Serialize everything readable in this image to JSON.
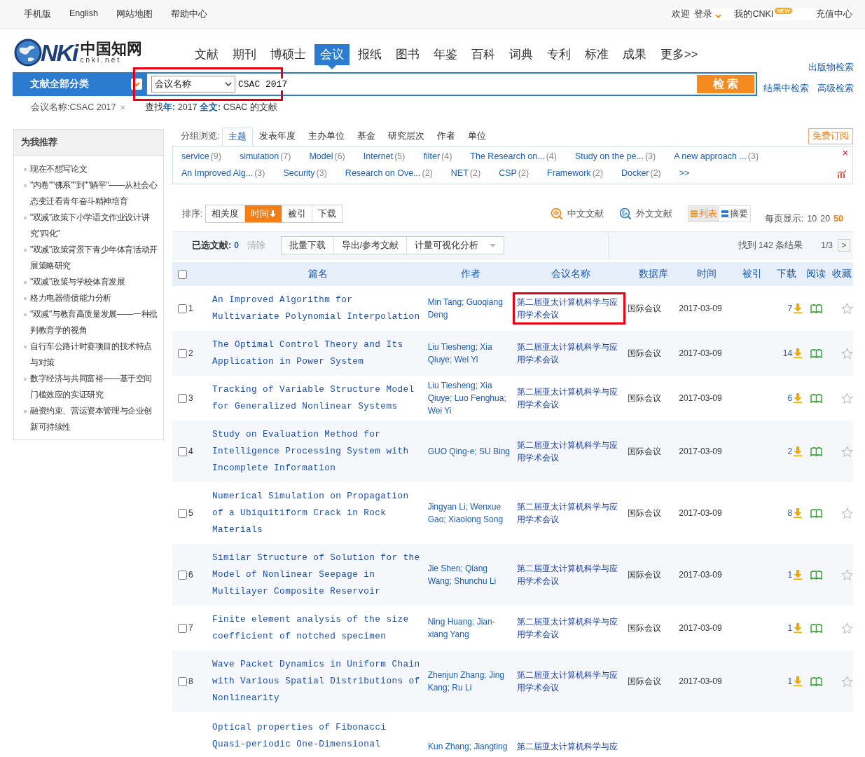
{
  "top_bar": {
    "left_links": [
      "手机版",
      "English",
      "网站地图",
      "帮助中心"
    ],
    "welcome": "欢迎",
    "login": "登录",
    "my_cnki": "我的CNKI",
    "new_badge": "NEW",
    "recharge": "充值中心"
  },
  "logo": {
    "letters": "NKi",
    "chinese": "中国知网",
    "domain": "cnki.net"
  },
  "nav": [
    {
      "label": "文献",
      "selected": false
    },
    {
      "label": "期刊",
      "selected": false
    },
    {
      "label": "博硕士",
      "selected": false
    },
    {
      "label": "会议",
      "selected": true
    },
    {
      "label": "报纸",
      "selected": false
    },
    {
      "label": "图书",
      "selected": false
    },
    {
      "label": "年鉴",
      "selected": false
    },
    {
      "label": "百科",
      "selected": false
    },
    {
      "label": "词典",
      "selected": false
    },
    {
      "label": "专利",
      "selected": false
    },
    {
      "label": "标准",
      "selected": false
    },
    {
      "label": "成果",
      "selected": false
    },
    {
      "label": "更多>>",
      "selected": false
    }
  ],
  "search": {
    "category": "文献全部分类",
    "field": "会议名称",
    "value": "CSAC 2017",
    "button": "检 索",
    "highlighted": true,
    "links": [
      "出版物检索",
      "结果中检索",
      "高级检索"
    ]
  },
  "filter_chip": "会议名称:CSAC 2017",
  "filter_remove": "×",
  "query_summary": "查找**年:** 2017 **全文:** CSAC 的文献",
  "sidebar": {
    "title": "为我推荐",
    "items": [
      "现在不想写论文",
      "\"内卷\"\"佛系\"\"到\"\"躺平\"——从社会心态变迁看青年奋斗精神培育",
      "\"双减\"政策下小学语文作业设计讲究\"四化\"",
      "\"双减\"政策背景下青少年体育活动开展策略研究",
      "\"双减\"政策与学校体育发展",
      "格力电器偿债能力分析",
      "\"双减\"与教育高质量发展——一种批判教育学的视角",
      "自行车公路计时赛项目的技术特点与对策",
      "数字经济与共同富裕——基于空间门槛效应的实证研究",
      "融资约束、营运资本管理与企业创新可持续性"
    ]
  },
  "group_tabs": {
    "label": "分组浏览:",
    "tabs": [
      {
        "label": "主题",
        "selected": true
      },
      {
        "label": "发表年度",
        "selected": false
      },
      {
        "label": "主办单位",
        "selected": false
      },
      {
        "label": "基金",
        "selected": false
      },
      {
        "label": "研究层次",
        "selected": false
      },
      {
        "label": "作者",
        "selected": false
      },
      {
        "label": "单位",
        "selected": false
      }
    ],
    "subscribe": "免费订阅"
  },
  "topics": [
    {
      "label": "service",
      "count": "(9)"
    },
    {
      "label": "simulation",
      "count": "(7)"
    },
    {
      "label": "Model",
      "count": "(6)"
    },
    {
      "label": "Internet",
      "count": "(5)"
    },
    {
      "label": "filter",
      "count": "(4)"
    },
    {
      "label": "The Research on...",
      "count": "(4)"
    },
    {
      "label": "Study on the pe...",
      "count": "(3)"
    },
    {
      "label": "A new approach ...",
      "count": "(3)"
    },
    {
      "label": "An Improved Alg...",
      "count": "(3)"
    },
    {
      "label": "Security",
      "count": "(3)"
    },
    {
      "label": "Research on Ove...",
      "count": "(2)"
    },
    {
      "label": "NET",
      "count": "(2)"
    },
    {
      "label": "CSP",
      "count": "(2)"
    },
    {
      "label": "Framework",
      "count": "(2)"
    },
    {
      "label": "Docker",
      "count": "(2)"
    }
  ],
  "topics_more": ">>",
  "topics_close": "×",
  "sort": {
    "label": "排序:",
    "options": [
      {
        "label": "相关度",
        "selected": false
      },
      {
        "label": "时间",
        "selected": true
      },
      {
        "label": "被引",
        "selected": false
      },
      {
        "label": "下载",
        "selected": false
      }
    ]
  },
  "languages": [
    "中文文献",
    "外文文献"
  ],
  "views": [
    {
      "label": "列表",
      "selected": true
    },
    {
      "label": "摘要",
      "selected": false
    }
  ],
  "per_page": {
    "label": "每页显示:",
    "options": [
      {
        "label": "10",
        "selected": false
      },
      {
        "label": "20",
        "selected": false
      },
      {
        "label": "50",
        "selected": true
      }
    ]
  },
  "selection": {
    "label": "已选文献:",
    "count": "0",
    "clear": "清除",
    "buttons": [
      "批量下载",
      "导出/参考文献",
      "计量可视化分析"
    ],
    "results": "找到 142 条结果",
    "page": "1/3",
    "next": ">"
  },
  "select_all": {
    "checked": false
  },
  "columns": [
    "篇名",
    "作者",
    "会议名称",
    "数据库",
    "时间",
    "被引",
    "下载",
    "阅读",
    "收藏"
  ],
  "rows": [
    {
      "checked": false,
      "num": "1",
      "title": "An Improved Algorithm for Multivariate Polynomial Interpolation",
      "authors": "Min Tang; Guoqiang Deng",
      "conference": "第二届亚太计算机科学与应用学术会议",
      "highlighted": true,
      "database": "国际会议",
      "date": "2017-03-09",
      "downloads": "7"
    },
    {
      "checked": false,
      "num": "2",
      "title": "The Optimal Control Theory and Its Application in Power System",
      "authors": "Liu Tiesheng; Xia Qiuye; Wei Yi",
      "conference": "第二届亚太计算机科学与应用学术会议",
      "highlighted": false,
      "database": "国际会议",
      "date": "2017-03-09",
      "downloads": "14"
    },
    {
      "checked": false,
      "num": "3",
      "title": "Tracking of Variable Structure Model for Generalized Nonlinear Systems",
      "authors": "Liu Tiesheng; Xia Qiuye; Luo Fenghua; Wei Yi",
      "conference": "第二届亚太计算机科学与应用学术会议",
      "highlighted": false,
      "database": "国际会议",
      "date": "2017-03-09",
      "downloads": "6"
    },
    {
      "checked": false,
      "num": "4",
      "title": "Study on Evaluation Method for Intelligence Processing System with Incomplete Information",
      "authors": "GUO Qing-e; SU Bing",
      "conference": "第二届亚太计算机科学与应用学术会议",
      "highlighted": false,
      "database": "国际会议",
      "date": "2017-03-09",
      "downloads": "2"
    },
    {
      "checked": false,
      "num": "5",
      "title": "Numerical Simulation on Propagation of a Ubiquitiform Crack in Rock Materials",
      "authors": "Jingyan Li; Wenxue Gao; Xiaolong Song",
      "conference": "第二届亚太计算机科学与应用学术会议",
      "highlighted": false,
      "database": "国际会议",
      "date": "2017-03-09",
      "downloads": "8"
    },
    {
      "checked": false,
      "num": "6",
      "title": "Similar Structure of Solution for the Model of Nonlinear Seepage in Multilayer Composite Reservoir",
      "authors": "Jie Shen; Qiang Wang; Shunchu Li",
      "conference": "第二届亚太计算机科学与应用学术会议",
      "highlighted": false,
      "database": "国际会议",
      "date": "2017-03-09",
      "downloads": "1"
    },
    {
      "checked": false,
      "num": "7",
      "title": "Finite element analysis of the size coefficient of notched specimen",
      "authors": "Ning Huang; Jian-xiang Yang",
      "conference": "第二届亚太计算机科学与应用学术会议",
      "highlighted": false,
      "database": "国际会议",
      "date": "2017-03-09",
      "downloads": "1"
    },
    {
      "checked": false,
      "num": "8",
      "title": "Wave Packet Dynamics in Uniform Chain with Various Spatial Distributions of Nonlinearity",
      "authors": "Zhenjun Zhang; Jing Kang; Ru Li",
      "conference": "第二届亚太计算机科学与应用学术会议",
      "highlighted": false,
      "database": "国际会议",
      "date": "2017-03-09",
      "downloads": "1"
    }
  ],
  "partial_row": {
    "title": "Optical properties of Fibonacci Quasi-periodic One-Dimensional",
    "authors": "Kun Zhang; Jiangting",
    "conference": "第二届亚太计算机科学与应"
  }
}
